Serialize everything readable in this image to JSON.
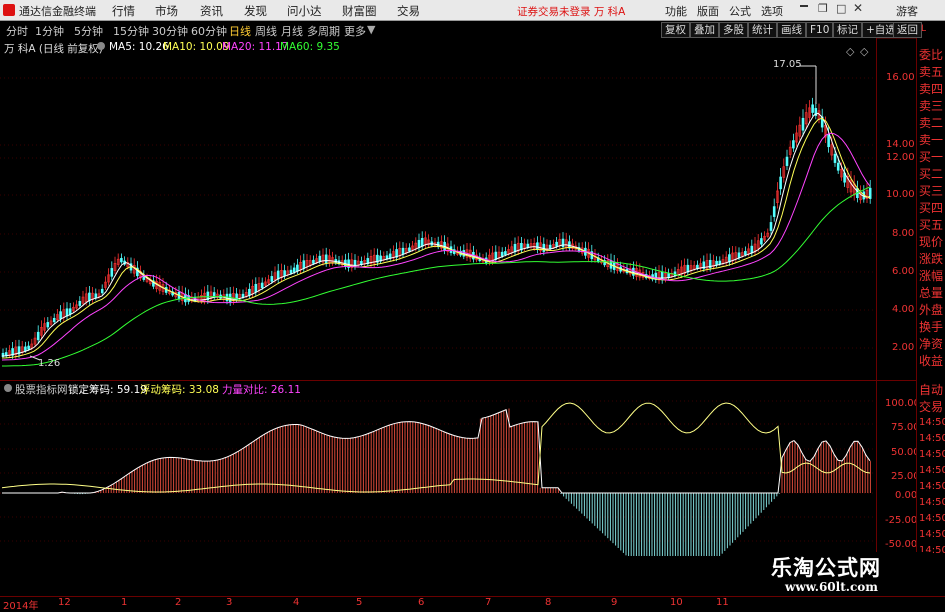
{
  "topbar": {
    "app_title": "通达信金融终端",
    "menus": [
      "行情",
      "市场",
      "资讯",
      "发现",
      "问小达",
      "财富圈",
      "交易"
    ],
    "center_msg": "证券交易未登录  万 科A",
    "right_buttons": [
      "功能",
      "版面",
      "公式",
      "选项",
      "游客"
    ]
  },
  "periods": [
    "分时",
    "1分钟",
    "5分钟",
    "15分钟",
    "30分钟",
    "60分钟",
    "日线",
    "周线",
    "月线",
    "多周期",
    "更多"
  ],
  "active_period": "日线",
  "toolbar_right": [
    "复权",
    "叠加",
    "多股",
    "统计",
    "画线",
    "F10",
    "标记",
    "+自选",
    "返回"
  ],
  "main_legend": {
    "stock": "万 科A (日线 前复权)",
    "ma5": "MA5: 10.26",
    "ma10": "MA10: 10.09",
    "ma20": "MA20: 11.17",
    "ma60": "MA60: 9.35"
  },
  "main_annotations": {
    "high": "17.05",
    "low": "1.26"
  },
  "main_yaxis": [
    "16.00",
    "14.00",
    "12.00",
    "10.00",
    "8.00",
    "6.00",
    "4.00",
    "2.00"
  ],
  "sub_legend": {
    "name": "股票指标网",
    "lock": "锁定筹码: 59.19",
    "float": "浮动筹码: 33.08",
    "power": "力量对比: 26.11"
  },
  "sub_yaxis": [
    "100.00",
    "75.00",
    "50.00",
    "25.00",
    "0.00",
    "-25.00",
    "-50.00"
  ],
  "xaxis": [
    "2014年",
    "12",
    "1",
    "2",
    "3",
    "4",
    "5",
    "6",
    "7",
    "8",
    "9",
    "10",
    "11"
  ],
  "rightpanel": [
    "委比",
    "卖五",
    "卖四",
    "卖三",
    "卖二",
    "卖一",
    "买一",
    "买二",
    "买三",
    "买四",
    "买五",
    "现价",
    "涨跌",
    "涨幅",
    "总量",
    "外盘",
    "换手",
    "净资",
    "收益",
    "自动",
    "交易",
    "14:50",
    "14:50",
    "14:50",
    "14:50",
    "14:50",
    "14:50",
    "14:50",
    "14:50",
    "14:50"
  ],
  "watermark": {
    "line1": "乐淘公式网",
    "line2": "www.60lt.com"
  },
  "colors": {
    "up": "#ff3333",
    "down": "#54ffff",
    "ma5": "#ffffff",
    "ma10": "#ffff55",
    "ma20": "#ff44ff",
    "ma60": "#33ff33"
  }
}
